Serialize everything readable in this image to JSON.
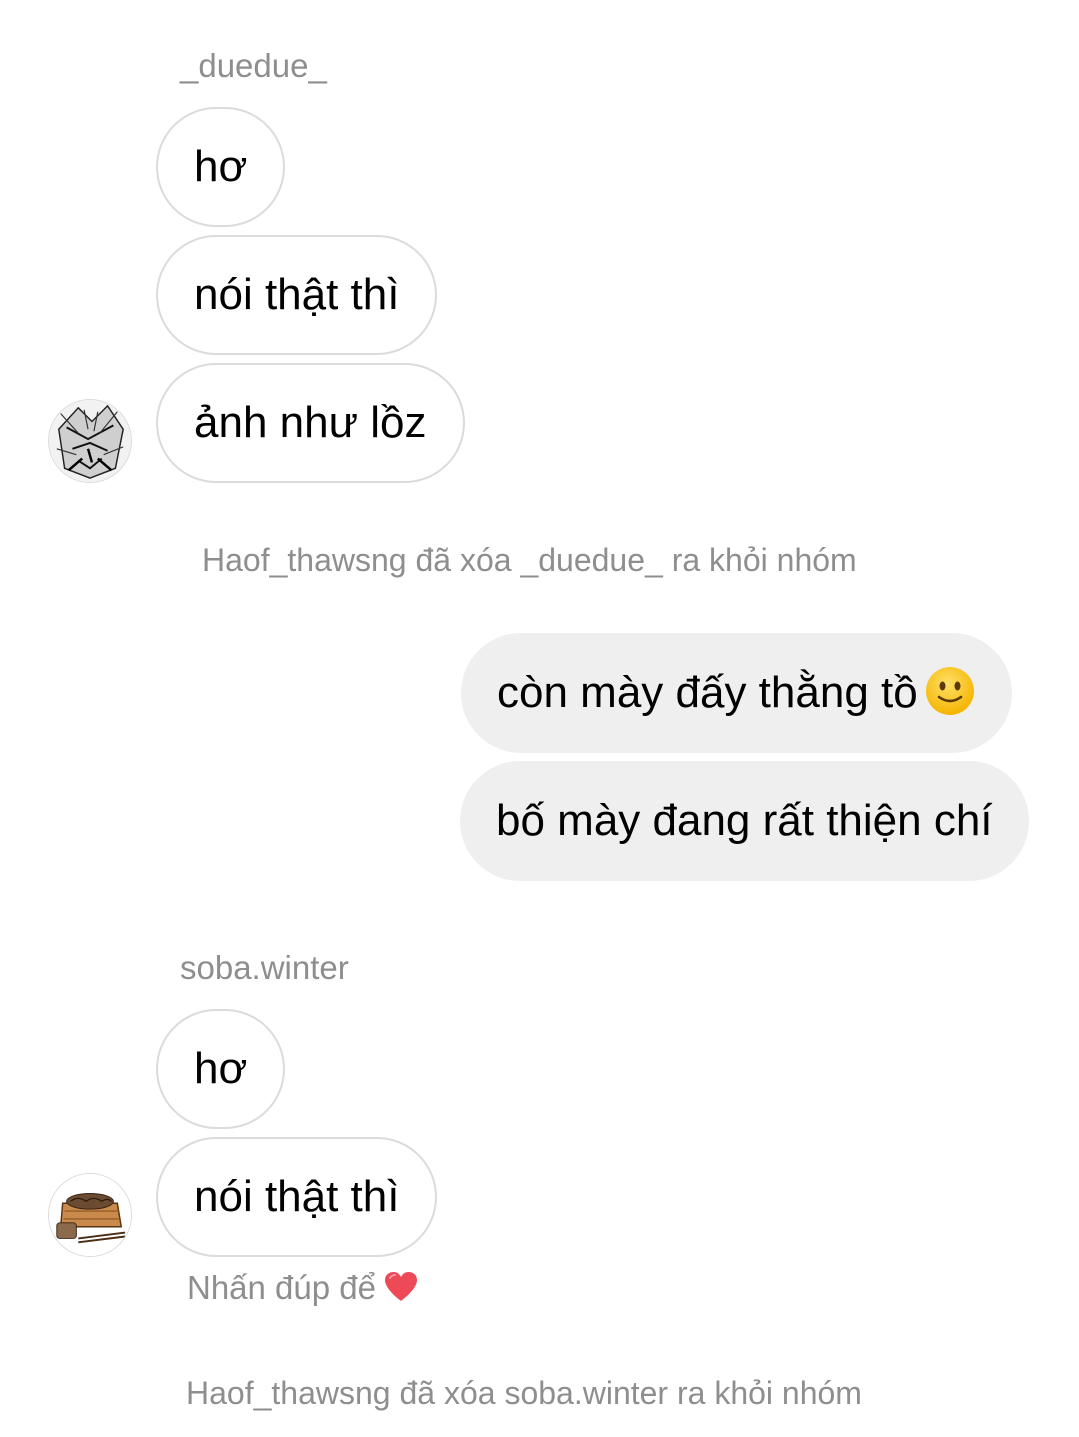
{
  "thread": {
    "group1": {
      "sender": "_duedue_",
      "messages": [
        "hơ",
        "nói thật thì",
        "ảnh như lồz"
      ],
      "avatar_icon": "manga-sketch-avatar"
    },
    "system_1": "Haof_thawsng đã xóa _duedue_ ra khỏi nhóm",
    "own_messages": [
      "còn mày đấy thằng tồ",
      "bố mày đang rất thiện chí"
    ],
    "own_emoji": "slightly-smiling-face-icon",
    "group2": {
      "sender": "soba.winter",
      "messages": [
        "hơ",
        "nói thật thì"
      ],
      "avatar_icon": "soba-noodles-avatar"
    },
    "double_tap_hint": "Nhấn đúp để",
    "hint_icon": "heart-icon",
    "system_2": "Haof_thawsng đã xóa soba.winter ra khỏi nhóm"
  },
  "colors": {
    "incoming_border": "#dbdbdb",
    "outgoing_bg": "#efefef",
    "muted_text": "#8e8e8e",
    "heart": "#ed4956",
    "emoji": "#ffcc33"
  }
}
